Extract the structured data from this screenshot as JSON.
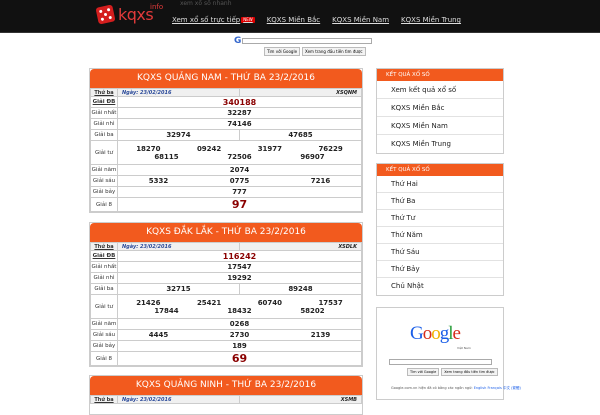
{
  "header": {
    "logo_text": "kqxs",
    "logo_sup": "info",
    "tagline": "xem xổ số nhanh",
    "nav": [
      {
        "label": "Xem xổ số trực tiếp",
        "badge": "NEW"
      },
      {
        "label": "KQXS Miền Bắc"
      },
      {
        "label": "KQXS Miền Nam"
      },
      {
        "label": "KQXS Miền Trung"
      }
    ]
  },
  "top_search": {
    "btn_search": "Tìm với Google",
    "btn_lucky": "Xem trang đầu tiên tìm được"
  },
  "results": [
    {
      "title": "KQXS QUẢNG NAM - THỨ BA 23/2/2016",
      "day": "Thứ ba",
      "date_label": "Ngày: 23/02/2016",
      "code": "XSQNM",
      "labels": [
        "Giải ĐB",
        "Giải nhất",
        "Giải nhì",
        "Giải ba",
        "Giải tư",
        "Giải năm",
        "Giải sáu",
        "Giải bảy",
        "Giải 8"
      ],
      "db": "340188",
      "g1": "32287",
      "g2": "74146",
      "g3": [
        "32974",
        "47685"
      ],
      "g4_row1": [
        "18270",
        "09242",
        "31977",
        "76229"
      ],
      "g4_row2": [
        "68115",
        "72506",
        "96907"
      ],
      "g5": "2074",
      "g6": [
        "5332",
        "0775",
        "7216"
      ],
      "g7": "777",
      "g8": "97"
    },
    {
      "title": "KQXS ĐẮK LẮK - THỨ BA 23/2/2016",
      "day": "Thứ ba",
      "date_label": "Ngày: 23/02/2016",
      "code": "XSDLK",
      "labels": [
        "Giải ĐB",
        "Giải nhất",
        "Giải nhì",
        "Giải ba",
        "Giải tư",
        "Giải năm",
        "Giải sáu",
        "Giải bảy",
        "Giải 8"
      ],
      "db": "116242",
      "g1": "17547",
      "g2": "19292",
      "g3": [
        "32715",
        "89248"
      ],
      "g4_row1": [
        "21426",
        "25421",
        "60740",
        "17537"
      ],
      "g4_row2": [
        "17844",
        "18432",
        "58202"
      ],
      "g5": "0268",
      "g6": [
        "4445",
        "2730",
        "2139"
      ],
      "g7": "189",
      "g8": "69"
    },
    {
      "title": "KQXS QUẢNG NINH - THỨ BA 23/2/2016",
      "day": "Thứ ba",
      "date_label": "Ngày: 23/02/2016",
      "code": "XSMB"
    }
  ],
  "sidebar": {
    "kqxs_title": "KẾT QUẢ XỔ SỐ",
    "kqxs_items": [
      "Xem kết quả xổ số",
      "KQXS Miền Bắc",
      "KQXS Miền Nam",
      "KQXS Miền Trung"
    ],
    "day_title": "KẾT QUẢ XỔ SỐ",
    "day_items": [
      "Thứ Hai",
      "Thứ Ba",
      "Thứ Tư",
      "Thứ Năm",
      "Thứ Sáu",
      "Thứ Bảy",
      "Chủ Nhật"
    ]
  },
  "google_box": {
    "logo": "Google",
    "sub": "Việt Nam",
    "btn_search": "Tìm với Google",
    "btn_lucky": "Xem trang đầu tiên tìm được",
    "footer": "Google.com.vn hiện đã có bằng các ngôn ngữ:",
    "langs": "English  Français  中文  (繁體)"
  },
  "colors": {
    "accent": "#f25a1e",
    "topbar": "#111111",
    "number_red": "#8a0000"
  }
}
